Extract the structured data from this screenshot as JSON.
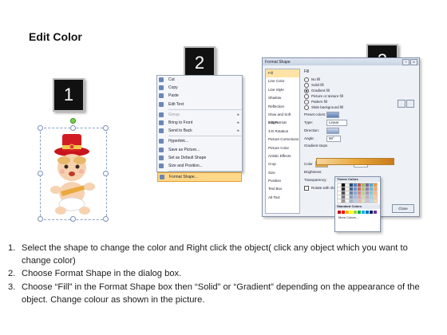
{
  "title": "Edit Color",
  "steps": [
    "1",
    "2",
    "3"
  ],
  "context_menu": {
    "items": [
      {
        "label": "Cut",
        "icon": "scissors-icon",
        "state": "normal"
      },
      {
        "label": "Copy",
        "icon": "copy-icon",
        "state": "normal"
      },
      {
        "label": "Paste",
        "icon": "paste-icon",
        "state": "normal"
      },
      {
        "label": "Edit Text",
        "icon": "edit-text-icon",
        "state": "normal"
      },
      {
        "label": "Group",
        "icon": "group-icon",
        "state": "disabled",
        "submenu": true
      },
      {
        "label": "Bring to Front",
        "icon": "bring-front-icon",
        "state": "normal",
        "submenu": true
      },
      {
        "label": "Send to Back",
        "icon": "send-back-icon",
        "state": "normal",
        "submenu": true
      },
      {
        "label": "Hyperlink...",
        "icon": "hyperlink-icon",
        "state": "normal"
      },
      {
        "label": "Save as Picture...",
        "icon": "save-picture-icon",
        "state": "normal"
      },
      {
        "label": "Set as Default Shape",
        "icon": "default-shape-icon",
        "state": "normal"
      },
      {
        "label": "Size and Position...",
        "icon": "size-position-icon",
        "state": "normal"
      },
      {
        "label": "Format Shape...",
        "icon": "format-shape-icon",
        "state": "highlight"
      }
    ]
  },
  "format_dialog": {
    "title": "Format Shape",
    "help_label": "?",
    "close_label": "X",
    "categories": [
      "Fill",
      "Line Color",
      "Line Style",
      "Shadow",
      "Reflection",
      "Glow and Soft Edges",
      "3-D Format",
      "3-D Rotation",
      "Picture Corrections",
      "Picture Color",
      "Artistic Effects",
      "Crop",
      "Size",
      "Position",
      "Text Box",
      "Alt Text"
    ],
    "active_category": "Fill",
    "fill_heading": "Fill",
    "fill_options": [
      {
        "label": "No fill",
        "selected": false
      },
      {
        "label": "Solid fill",
        "selected": false
      },
      {
        "label": "Gradient fill",
        "selected": true
      },
      {
        "label": "Picture or texture fill",
        "selected": false
      },
      {
        "label": "Pattern fill",
        "selected": false
      },
      {
        "label": "Slide background fill",
        "selected": false
      }
    ],
    "preset_colors_label": "Preset colors:",
    "type_label": "Type:",
    "type_value": "Linear",
    "direction_label": "Direction:",
    "angle_label": "Angle:",
    "angle_value": "90°",
    "gradient_stops_label": "Gradient stops",
    "color_label": "Color",
    "position_label": "Position:",
    "position_value": "0%",
    "brightness_label": "Brightness:",
    "transparency_label": "Transparency:",
    "rotate_label": "Rotate with shape",
    "close_button": "Close",
    "gradient_colors": [
      "#f6d7a0",
      "#e9a93d",
      "#c97b1a"
    ]
  },
  "theme_popup": {
    "theme_heading": "Theme Colors",
    "standard_heading": "Standard Colors",
    "more_label": "More Colors...",
    "theme_top": [
      "#ffffff",
      "#000000",
      "#eeece1",
      "#1f497d",
      "#4f81bd",
      "#c0504d",
      "#9bbb59",
      "#8064a2",
      "#4bacc6",
      "#f79646"
    ],
    "standard": [
      "#c00000",
      "#ff0000",
      "#ffc000",
      "#ffff00",
      "#92d050",
      "#00b050",
      "#00b0f0",
      "#0070c0",
      "#002060",
      "#7030a0"
    ]
  },
  "instructions": [
    {
      "num": "1.",
      "text": "Select the shape to change the color and Right click the object( click any object which you want to change color)"
    },
    {
      "num": "2.",
      "text": "Choose Format Shape in the dialog box."
    },
    {
      "num": "3.",
      "text": "Choose “Fill” in the Format Shape box then “Solid” or “Gradient” depending on the appearance of the object. Change colour as shown in the picture."
    }
  ]
}
